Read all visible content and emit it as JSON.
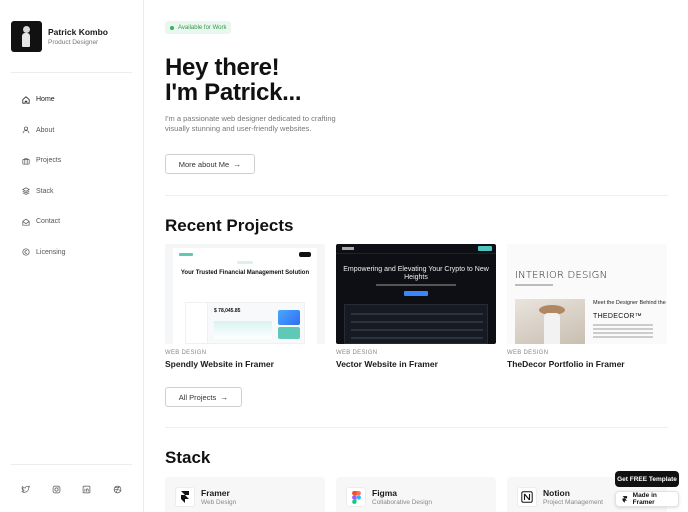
{
  "profile": {
    "name": "Patrick Kombo",
    "role": "Product Designer"
  },
  "nav": [
    {
      "label": "Home",
      "icon": "home-icon",
      "active": true
    },
    {
      "label": "About",
      "icon": "user-icon",
      "active": false
    },
    {
      "label": "Projects",
      "icon": "briefcase-icon",
      "active": false
    },
    {
      "label": "Stack",
      "icon": "layers-icon",
      "active": false
    },
    {
      "label": "Contact",
      "icon": "mail-open-icon",
      "active": false
    },
    {
      "label": "Licensing",
      "icon": "copyright-icon",
      "active": false
    }
  ],
  "socials": [
    "twitter-icon",
    "instagram-icon",
    "linkedin-icon",
    "dribbble-icon"
  ],
  "hero": {
    "badge": "Available for Work",
    "title_line1": "Hey there!",
    "title_line2": "I'm Patrick...",
    "subtitle": "I'm  a passionate web designer dedicated to crafting visually stunning and user-friendly websites.",
    "button": "More about Me"
  },
  "projects": {
    "title": "Recent Projects",
    "items": [
      {
        "category": "WEB DESIGN",
        "name": "Spendly Website in Framer",
        "thumb": {
          "logo": "spendly",
          "headline": "Your Trusted Financial Management Solution",
          "figure": "$ 78,045.85"
        }
      },
      {
        "category": "WEB DESIGN",
        "name": "Vector Website in Framer",
        "thumb": {
          "headline": "Empowering and Elevating Your Crypto to New Heights"
        }
      },
      {
        "category": "WEB DESIGN",
        "name": "TheDecor Portfolio in Framer",
        "thumb": {
          "headline": "INTERIOR DESIGN",
          "meet": "Meet the Designer Behind the",
          "brand": "THEDECOR™"
        }
      }
    ],
    "button": "All Projects"
  },
  "stack": {
    "title": "Stack",
    "items": [
      {
        "name": "Framer",
        "desc": "Web Design",
        "icon": "framer-icon"
      },
      {
        "name": "Figma",
        "desc": "Collaborative Design",
        "icon": "figma-icon"
      },
      {
        "name": "Notion",
        "desc": "Project Management",
        "icon": "notion-icon"
      }
    ]
  },
  "floating": {
    "template": "Get FREE Template",
    "made_in": "Made in Framer"
  },
  "colors": {
    "badge_bg": "#eaf7ee",
    "badge_text": "#2e9a4e",
    "accent_teal": "#5fc9b6"
  }
}
